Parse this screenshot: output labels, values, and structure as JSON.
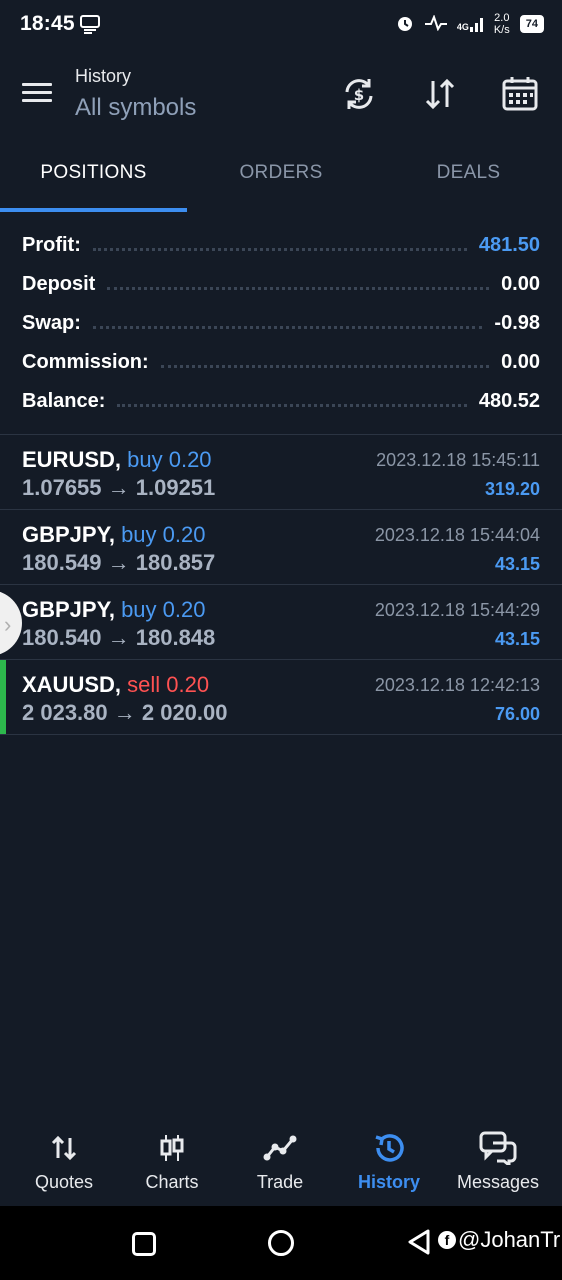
{
  "status_bar": {
    "time": "18:45",
    "network": "4G",
    "speed_top": "2.0",
    "speed_bottom": "K/s",
    "battery": "74"
  },
  "header": {
    "title": "History",
    "subtitle": "All symbols",
    "icons": [
      "currency-exchange-icon",
      "sort-icon",
      "calendar-icon"
    ]
  },
  "tabs": [
    {
      "label": "POSITIONS",
      "active": true
    },
    {
      "label": "ORDERS",
      "active": false
    },
    {
      "label": "DEALS",
      "active": false
    }
  ],
  "summary": {
    "profit_label": "Profit:",
    "profit_value": "481.50",
    "deposit_label": "Deposit",
    "deposit_value": "0.00",
    "swap_label": "Swap:",
    "swap_value": "-0.98",
    "commission_label": "Commission:",
    "commission_value": "0.00",
    "balance_label": "Balance:",
    "balance_value": "480.52"
  },
  "positions": [
    {
      "symbol": "EURUSD,",
      "side": "buy 0.20",
      "prices": "1.07655 → 1.09251",
      "time": "2023.12.18 15:45:11",
      "profit": "319.20"
    },
    {
      "symbol": "GBPJPY,",
      "side": "buy 0.20",
      "prices": "180.549 → 180.857",
      "time": "2023.12.18 15:44:04",
      "profit": "43.15"
    },
    {
      "symbol": "GBPJPY,",
      "side": "buy 0.20",
      "prices": "180.540 → 180.848",
      "time": "2023.12.18 15:44:29",
      "profit": "43.15"
    },
    {
      "symbol": "XAUUSD,",
      "side": "sell 0.20",
      "prices": "2 023.80 → 2 020.00",
      "time": "2023.12.18 12:42:13",
      "profit": "76.00"
    }
  ],
  "colors": {
    "background": "#141b26",
    "accent": "#3d8ef0",
    "buy": "#4b9af2",
    "sell": "#ff5252",
    "indicator": "#2db84c"
  },
  "bottom_nav": [
    {
      "label": "Quotes",
      "icon": "arrows-up-down-icon",
      "active": false
    },
    {
      "label": "Charts",
      "icon": "candlestick-icon",
      "active": false
    },
    {
      "label": "Trade",
      "icon": "trend-line-icon",
      "active": false
    },
    {
      "label": "History",
      "icon": "history-clock-icon",
      "active": true
    },
    {
      "label": "Messages",
      "icon": "chat-bubbles-icon",
      "active": false
    }
  ],
  "system_bar": {
    "watermark": "@JohanTr"
  }
}
